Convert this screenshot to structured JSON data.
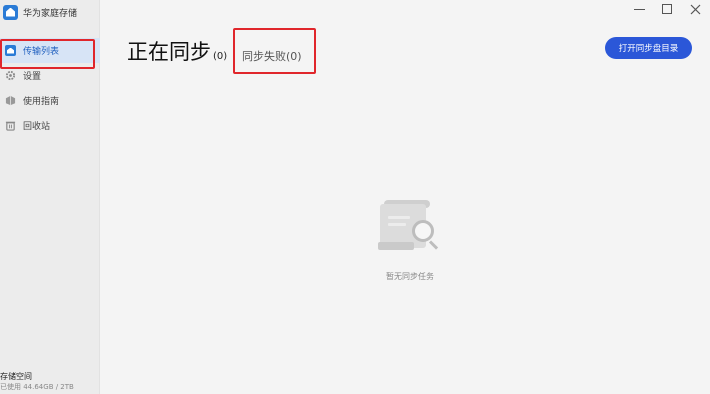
{
  "app": {
    "title": "华为家庭存储"
  },
  "sidebar": {
    "items": [
      {
        "label": "传输列表",
        "icon": "home-icon",
        "active": true
      },
      {
        "label": "设置",
        "icon": "gear-icon"
      },
      {
        "label": "使用指南",
        "icon": "guide-icon"
      },
      {
        "label": "回收站",
        "icon": "trash-icon"
      }
    ],
    "storage": {
      "title": "存储空间",
      "usage": "已使用 44.64GB / 2TB"
    }
  },
  "tabs": [
    {
      "label": "正在同步",
      "count": "(0)"
    },
    {
      "label": "同步失败(0)"
    }
  ],
  "actions": {
    "open_sync_dir": "打开同步盘目录"
  },
  "empty_state": {
    "text": "暂无同步任务",
    "icon": "document-search-icon"
  },
  "window_controls": {
    "icons": [
      "minimize-icon",
      "maximize-icon",
      "close-icon"
    ]
  },
  "colors": {
    "accent": "#2b57d8",
    "highlight": "#e0262b",
    "active_bg": "#d7e4f6"
  }
}
